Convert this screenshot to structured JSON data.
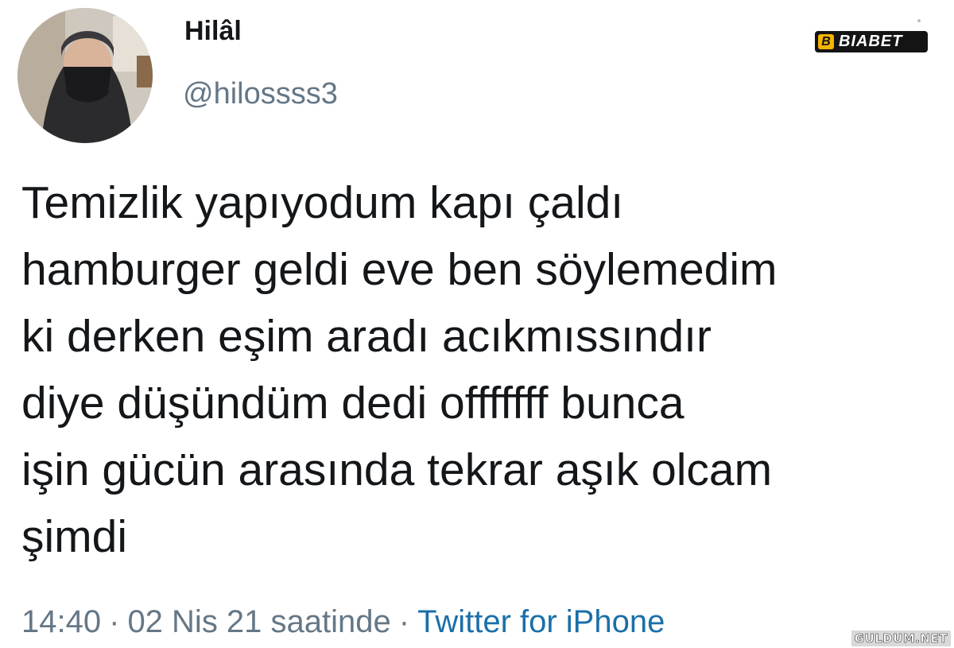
{
  "author": {
    "display_name": "Hilâl",
    "handle": "@hilossss3",
    "avatar": "profile-photo-masked-woman"
  },
  "tweet": {
    "lines": [
      "Temizlik yapıyodum kapı çaldı",
      "hamburger geldi eve ben söylemedim",
      "ki derken eşim aradı acıkmıssındır",
      "diye düşündüm dedi offfffff bunca",
      "işin gücün arasında tekrar aşık olcam",
      "şimdi"
    ]
  },
  "meta": {
    "time": "14:40",
    "separator": "·",
    "date": "02 Nis 21 saatinde",
    "source": "Twitter for iPhone"
  },
  "overlays": {
    "brand_mark": "B",
    "brand_text": "BIABET",
    "watermark": "GULDUM.NET"
  },
  "colors": {
    "text": "#14171a",
    "secondary": "#657786",
    "link": "#1b6fa8",
    "brand_accent": "#f5b400"
  }
}
